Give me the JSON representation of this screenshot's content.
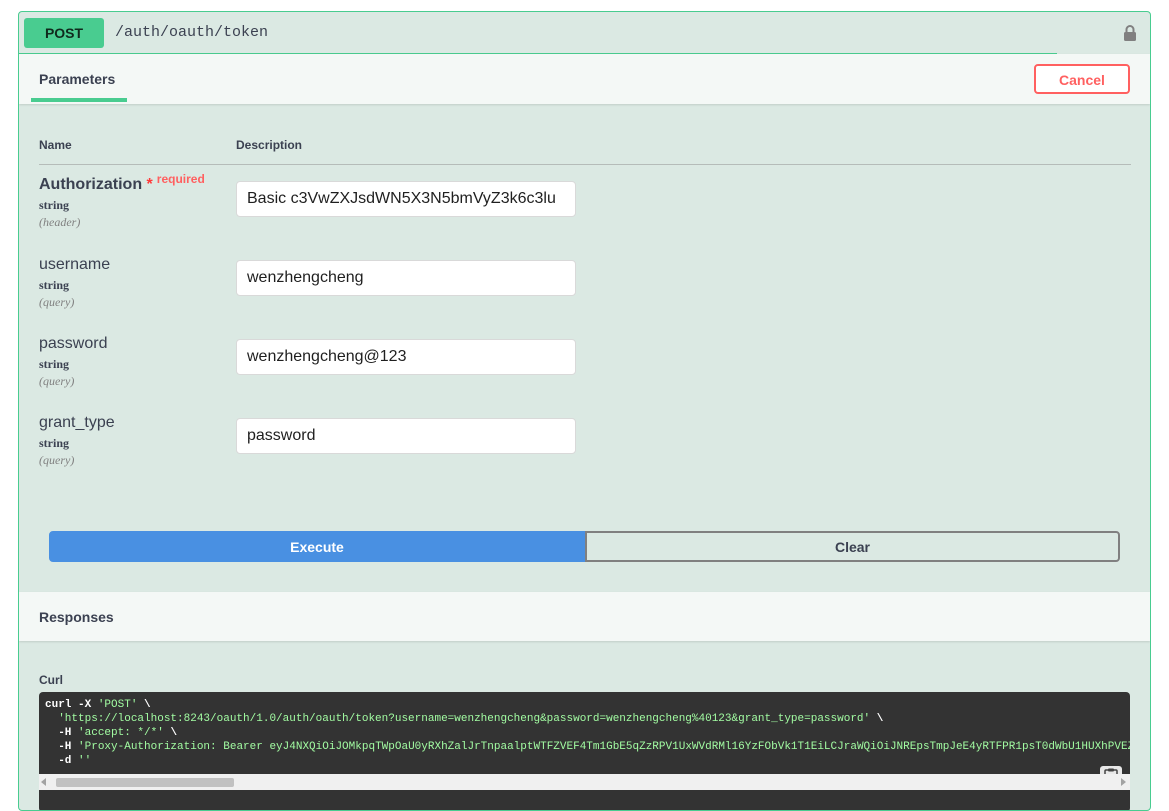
{
  "summary": {
    "method": "POST",
    "path": "/auth/oauth/token"
  },
  "params_header": {
    "tab_label": "Parameters",
    "cancel_label": "Cancel"
  },
  "table": {
    "col_name": "Name",
    "col_description": "Description"
  },
  "params": [
    {
      "name": "Authorization",
      "star": "*",
      "required_label": "required",
      "type": "string",
      "in": "(header)",
      "value": "Basic c3VwZXJsdWN5X3N5bmVyZ3k6c3lu"
    },
    {
      "name": "username",
      "type": "string",
      "in": "(query)",
      "value": "wenzhengcheng"
    },
    {
      "name": "password",
      "type": "string",
      "in": "(query)",
      "value": "wenzhengcheng@123"
    },
    {
      "name": "grant_type",
      "type": "string",
      "in": "(query)",
      "value": "password"
    }
  ],
  "buttons": {
    "execute": "Execute",
    "clear": "Clear"
  },
  "responses": {
    "title": "Responses",
    "curl_label": "Curl",
    "curl_lines": [
      {
        "plain": "curl -X ",
        "str": "'POST'",
        "tail": " \\"
      },
      {
        "plain": "  ",
        "str": "'https://localhost:8243/oauth/1.0/auth/oauth/token?username=wenzhengcheng&password=wenzhengcheng%40123&grant_type=password'",
        "tail": " \\"
      },
      {
        "plain": "  -H ",
        "str": "'accept: */*'",
        "tail": " \\"
      },
      {
        "plain": "  -H ",
        "str": "'Proxy-Authorization: Bearer eyJ4NXQiOiJOMkpqTWpOaU0yRXhZalJrTnpaalptWTFZVEF4Tm1GbE5qZzRPV1UxWVdRMl16YzFObVk1T1EiLCJraWQiOiJNREpsTmpJeE4yRTFPR1psT0dWbU1HUXhPVEZ",
        "tail": ""
      },
      {
        "plain": "  -d ",
        "str": "''",
        "tail": ""
      }
    ]
  },
  "colors": {
    "post_green": "#49cc90",
    "block_bg": "#dbe9e3",
    "execute_blue": "#4990e2",
    "cancel_red": "#ff6060",
    "curl_bg": "#333333"
  },
  "icons": [
    "lock-icon",
    "copy-icon",
    "scroll-left-icon",
    "scroll-right-icon"
  ]
}
